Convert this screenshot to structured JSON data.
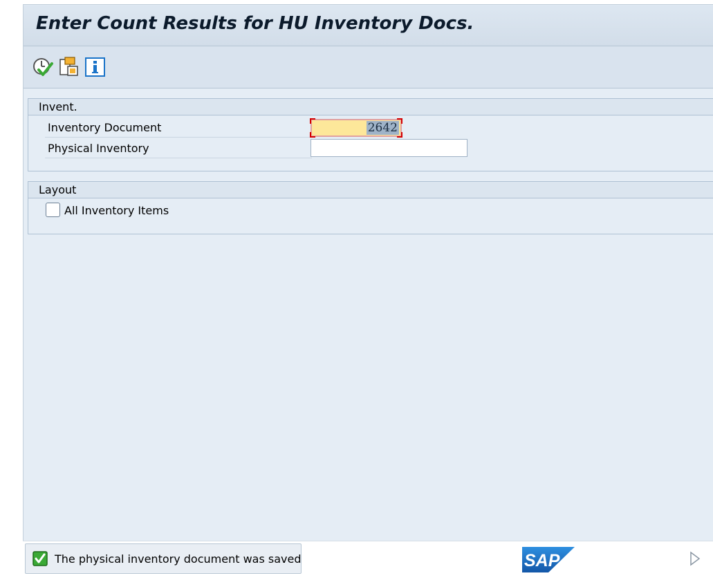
{
  "window": {
    "title": "Enter Count Results for HU Inventory Docs."
  },
  "toolbar": {
    "buttons": [
      {
        "icon": "execute-check-icon"
      },
      {
        "icon": "multiple-selection-icon"
      },
      {
        "icon": "info-icon"
      }
    ]
  },
  "invent_group": {
    "header": "Invent.",
    "inventory_document_label": "Inventory Document",
    "inventory_document_value": "2642",
    "physical_inventory_label": "Physical Inventory",
    "physical_inventory_value": ""
  },
  "layout_group": {
    "header": "Layout",
    "all_items_label": "All Inventory Items",
    "all_items_checked": false
  },
  "status_bar": {
    "message": "The physical inventory document was saved",
    "message_type": "success",
    "brand": "SAP"
  },
  "colors": {
    "required_field_bg": "#fde79a",
    "focus_corner": "#d40000",
    "brand_blue": "#1a73c8",
    "success_green": "#3aa935"
  }
}
